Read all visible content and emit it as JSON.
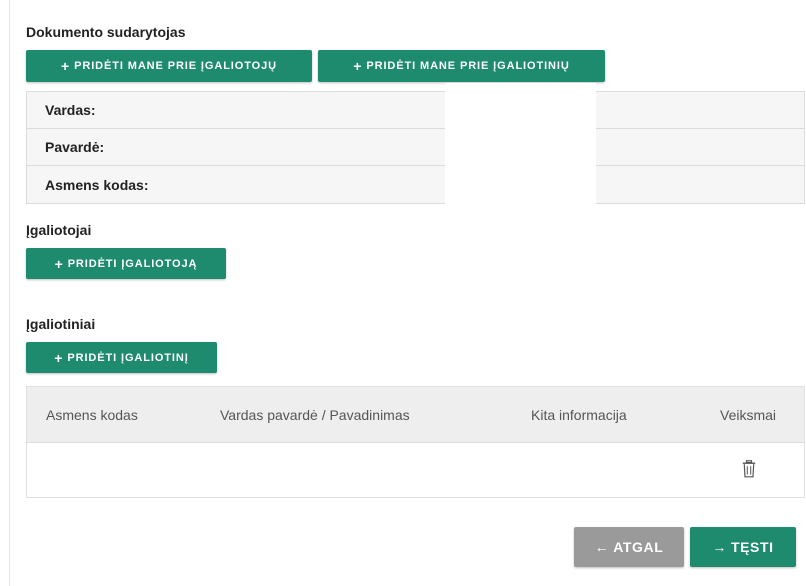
{
  "creator": {
    "title": "Dokumento sudarytojas",
    "add_me_to_grantors_label": "PRIDĖTI MANE PRIE ĮGALIOTOJŲ",
    "add_me_to_agents_label": "PRIDĖTI MANE PRIE ĮGALIOTINIŲ",
    "fields": [
      {
        "label": "Vardas:",
        "value": ""
      },
      {
        "label": "Pavardė:",
        "value": ""
      },
      {
        "label": "Asmens kodas:",
        "value": ""
      }
    ]
  },
  "grantors": {
    "title": "Įgaliotojai",
    "add_label": "PRIDĖTI ĮGALIOTOJĄ"
  },
  "agents": {
    "title": "Įgaliotiniai",
    "add_label": "PRIDĖTI ĮGALIOTINĮ",
    "table": {
      "columns": [
        "Asmens kodas",
        "Vardas pavardė / Pavadinimas",
        "Kita informacija",
        "Veiksmai"
      ],
      "rows": [
        {
          "personal_code": "",
          "name": "",
          "other_info": ""
        }
      ]
    }
  },
  "nav": {
    "back_label": "ATGAL",
    "continue_label": "TĘSTI"
  },
  "colors": {
    "primary": "#1e8a6e",
    "secondary": "#9a9a9a"
  },
  "icons": {
    "plus": "plus-icon",
    "trash": "trash-icon",
    "arrow_left": "arrow-left-icon",
    "arrow_right": "arrow-right-icon"
  }
}
